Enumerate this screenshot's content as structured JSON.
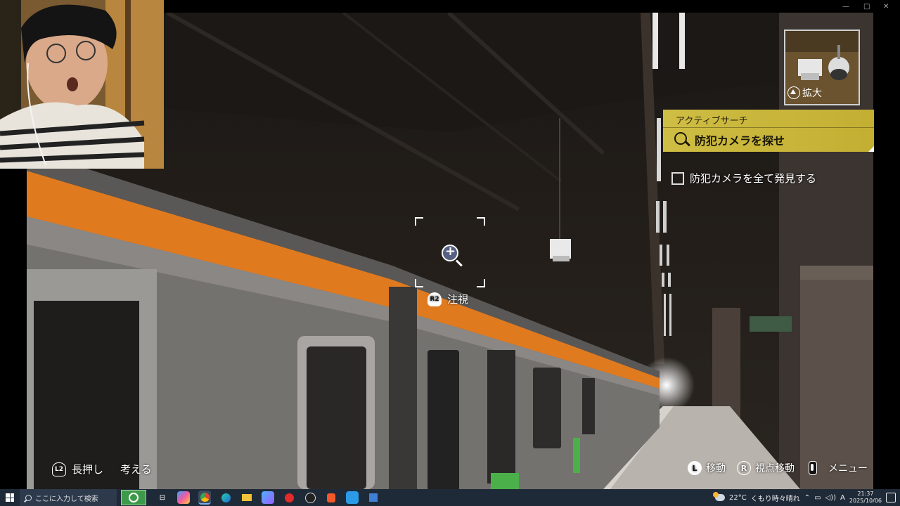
{
  "game": {
    "objective": {
      "header": "アクティブサーチ",
      "title": "防犯カメラを探せ",
      "subtask": "防犯カメラを全て発見する"
    },
    "thumbnail": {
      "action_label": "拡大",
      "button_icon": "triangle-button-icon"
    },
    "reticle": {
      "gaze_button": "R2",
      "gaze_label": "注視"
    },
    "bottom_left_hint": {
      "button": "L2",
      "text1": "長押し",
      "text2": "考える"
    },
    "controls": [
      {
        "button": "L",
        "label": "移動"
      },
      {
        "button": "R",
        "label": "視点移動"
      },
      {
        "button": "touchpad-icon",
        "label": "メニュー"
      }
    ]
  },
  "taskbar": {
    "search_placeholder": "ここに入力して検索",
    "apps": [
      "task-view-icon",
      "copilot-icon",
      "chrome-icon",
      "edge-icon",
      "file-explorer-icon",
      "app-icon",
      "youtube-icon",
      "obs-icon",
      "brave-icon",
      "app-icon-2",
      "app-icon-3"
    ],
    "weather": "22°C",
    "weather_text": "くもり時々晴れ",
    "ime": "A",
    "time": "21:37",
    "date": "2025/10/06"
  },
  "colors": {
    "objective_bg": "#d6c446",
    "train_stripe": "#e07a1f",
    "taskbar": "#1f2a38"
  }
}
